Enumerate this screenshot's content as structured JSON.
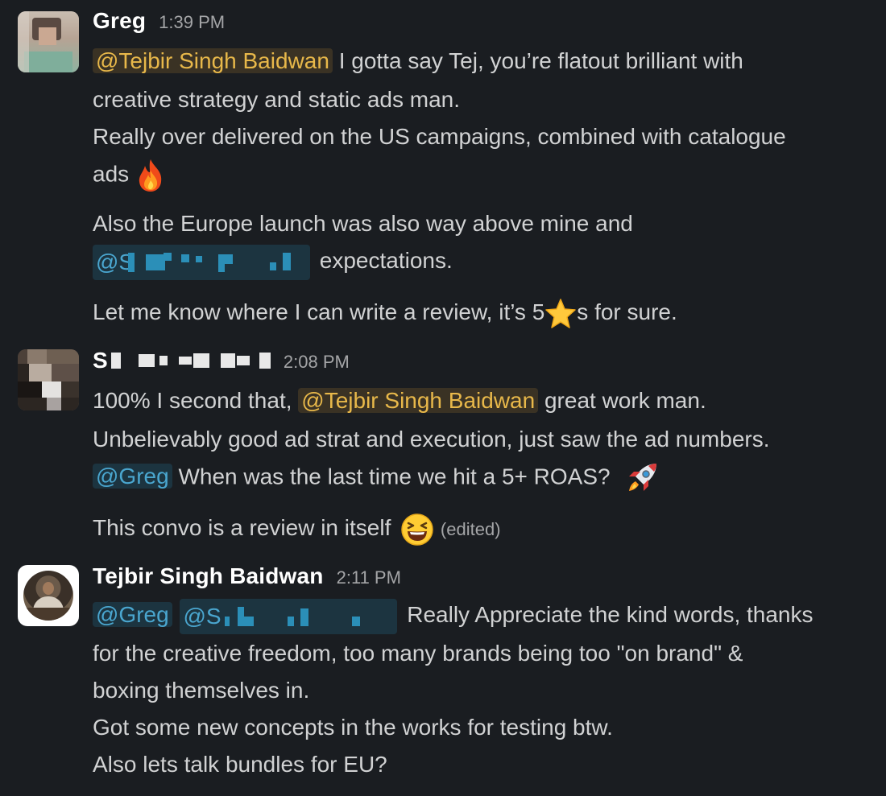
{
  "messages": [
    {
      "author": "Greg",
      "time": "1:39 PM",
      "lines": {
        "l1_mention": "@Tejbir Singh Baidwan",
        "l1_text": " I gotta say Tej, you’re flatout brilliant with",
        "l2": "creative strategy and static ads man.",
        "l3": "Really over delivered on the US campaigns, combined with catalogue",
        "l4": "ads",
        "l5": "Also the Europe launch was also way above mine and",
        "l6_mention": "@S",
        "l6_text": "expectations.",
        "l7_a": "Let me know where I can write a review, it’s 5",
        "l7_b": "s for sure."
      }
    },
    {
      "author_initial": "S",
      "time": "2:08 PM",
      "lines": {
        "l1_a": "100% I second that, ",
        "l1_mention": "@Tejbir Singh Baidwan",
        "l1_b": " great work man.",
        "l2": "Unbelievably good ad strat and execution, just saw the ad numbers.",
        "l3_mention": "@Greg",
        "l3_text": " When was the last time we hit a 5+ ROAS?",
        "l4": "This convo is a review in itself",
        "edited": "(edited)"
      }
    },
    {
      "author": "Tejbir Singh Baidwan",
      "time": "2:11 PM",
      "lines": {
        "l1_mention_a": "@Greg",
        "l1_mention_b": "@S",
        "l1_text": "Really Appreciate the kind words, thanks",
        "l2": "for the creative freedom, too many brands being too \"on brand\" &",
        "l3": "boxing themselves in.",
        "l4": "Got some new concepts in the works for testing btw.",
        "l5": "Also lets talk bundles for EU?"
      }
    }
  ],
  "icons": {
    "fire": "fire-emoji-icon",
    "star": "star-emoji-icon",
    "rocket": "rocket-emoji-icon",
    "laugh": "laughing-emoji-icon"
  },
  "colors": {
    "background": "#1a1d21",
    "text": "#d1d2d3",
    "mention_self": "#e8b84a",
    "mention_other": "#4aa6cf",
    "timestamp": "#a4a5a7"
  }
}
